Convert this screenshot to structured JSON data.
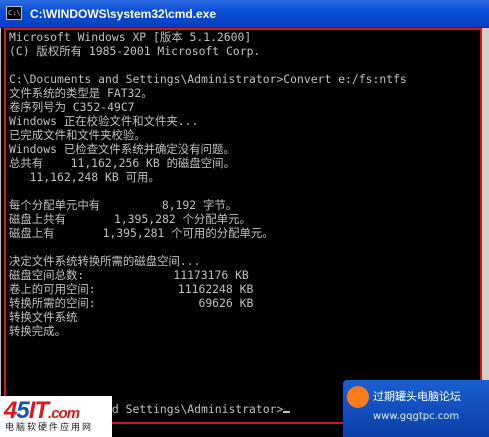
{
  "window": {
    "title": "C:\\WINDOWS\\system32\\cmd.exe",
    "icon_text": "C:\\"
  },
  "console": {
    "lines": [
      "Microsoft Windows XP [版本 5.1.2600]",
      "(C) 版权所有 1985-2001 Microsoft Corp.",
      "",
      "C:\\Documents and Settings\\Administrator>Convert e:/fs:ntfs",
      "文件系统的类型是 FAT32。",
      "卷序列号为 C352-49C7",
      "Windows 正在校验文件和文件夹...",
      "已完成文件和文件夹校验。",
      "Windows 已检查文件系统并确定没有问题。",
      "总共有    11,162,256 KB 的磁盘空间。",
      "   11,162,248 KB 可用。",
      "",
      "每个分配单元中有         8,192 字节。",
      "磁盘上共有       1,395,282 个分配单元。",
      "磁盘上有       1,395,281 个可用的分配单元。",
      "",
      "决定文件系统转换所需的磁盘空间...",
      "磁盘空间总数:             11173176 KB",
      "卷上的可用空间:            11162248 KB",
      "转换所需的空间:               69626 KB",
      "转换文件系统",
      "转换完成。",
      "",
      "C:\\Documents and Settings\\Administrator>"
    ]
  },
  "logo": {
    "mark_a": "4",
    "mark_b": "5",
    "mark_c": "IT",
    "mark_d": ".com",
    "subtitle": "电脑软硬件应用网"
  },
  "watermark": {
    "text": "过期罐头电脑论坛",
    "url": "www.gqgtpc.com"
  },
  "colors": {
    "console_bg": "#000000",
    "console_fg": "#c0c0c0",
    "titlebar": "#0a4fd8",
    "annotation_frame": "#d01818"
  }
}
